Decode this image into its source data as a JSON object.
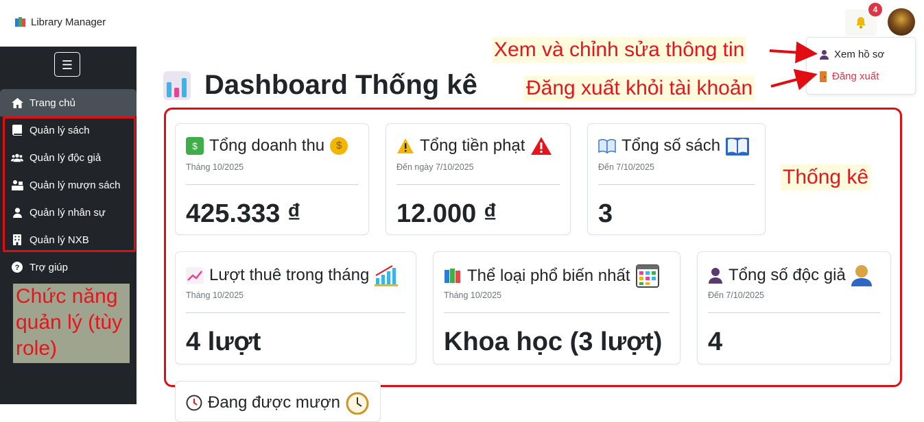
{
  "app": {
    "title": "Library Manager"
  },
  "header": {
    "notification_count": "4"
  },
  "user_menu": {
    "profile_label": "Xem hồ sơ",
    "logout_label": "Đăng xuất"
  },
  "sidebar": {
    "toggle_label": "☰",
    "items": [
      {
        "label": "Trang chủ",
        "icon": "home-icon"
      },
      {
        "label": "Quản lý sách",
        "icon": "book-icon"
      },
      {
        "label": "Quản lý độc giả",
        "icon": "users-icon"
      },
      {
        "label": "Quản lý mượn sách",
        "icon": "borrow-icon"
      },
      {
        "label": "Quản lý nhân sự",
        "icon": "staff-icon"
      },
      {
        "label": "Quản lý NXB",
        "icon": "building-icon"
      },
      {
        "label": "Trợ giúp",
        "icon": "help-icon"
      }
    ],
    "role_note": "Chức năng quản lý (tùy role)"
  },
  "main": {
    "title": "Dashboard Thống kê",
    "stats_label": "Thống kê",
    "cards": [
      {
        "title": "Tổng doanh thu",
        "subtitle": "Tháng 10/2025",
        "value": "425.333 ₫"
      },
      {
        "title": "Tổng tiền phạt",
        "subtitle": "Đến ngày 7/10/2025",
        "value": "12.000 ₫"
      },
      {
        "title": "Tổng số sách",
        "subtitle": "Đến 7/10/2025",
        "value": "3"
      },
      {
        "title": "Lượt thuê trong tháng",
        "subtitle": "Tháng 10/2025",
        "value": "4 lượt"
      },
      {
        "title": "Thể loại phổ biến nhất",
        "subtitle": "Tháng 10/2025",
        "value": "Khoa học (3 lượt)"
      },
      {
        "title": "Tổng số độc giả",
        "subtitle": "Đến 7/10/2025",
        "value": "4"
      },
      {
        "title": "Đang được mượn"
      }
    ]
  },
  "annotations": {
    "profile_hint": "Xem và chỉnh sửa thông tin",
    "logout_hint": "Đăng xuất khỏi tài khoản"
  },
  "colors": {
    "sidebar_bg": "#212529",
    "annotation_red": "#e00d12",
    "logout_red": "#dc3545"
  }
}
